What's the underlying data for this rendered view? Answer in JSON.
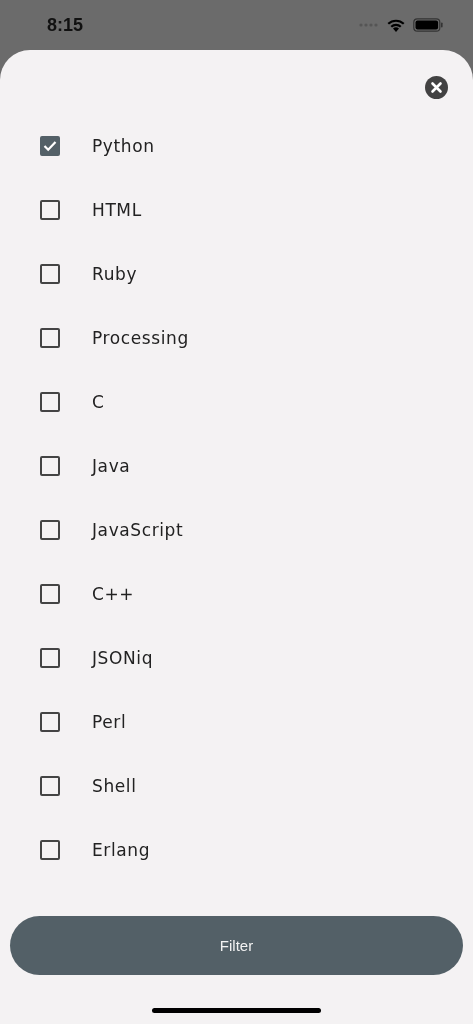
{
  "status_bar": {
    "time": "8:15"
  },
  "options": [
    {
      "label": "Python",
      "checked": true
    },
    {
      "label": "HTML",
      "checked": false
    },
    {
      "label": "Ruby",
      "checked": false
    },
    {
      "label": "Processing",
      "checked": false
    },
    {
      "label": "C",
      "checked": false
    },
    {
      "label": "Java",
      "checked": false
    },
    {
      "label": "JavaScript",
      "checked": false
    },
    {
      "label": "C++",
      "checked": false
    },
    {
      "label": "JSONiq",
      "checked": false
    },
    {
      "label": "Perl",
      "checked": false
    },
    {
      "label": "Shell",
      "checked": false
    },
    {
      "label": "Erlang",
      "checked": false
    }
  ],
  "button": {
    "label": "Filter"
  }
}
